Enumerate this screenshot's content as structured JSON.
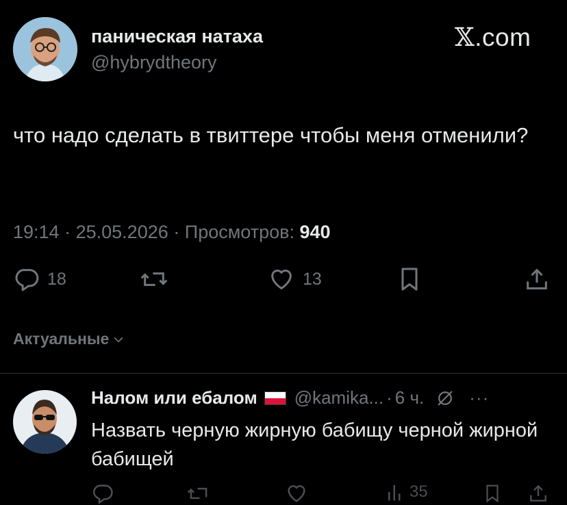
{
  "brand": {
    "x": "𝕏",
    "suffix": ".com"
  },
  "author": {
    "name": "паническая натаха",
    "handle": "@hybrydtheory"
  },
  "tweet": {
    "text": "что надо сделать в твиттере чтобы меня отменили?"
  },
  "meta": {
    "time": "19:14",
    "date": "25.05.2026",
    "views_label": "Просмотров:",
    "views_count": "940"
  },
  "actions": {
    "replies": "18",
    "likes": "13"
  },
  "section": {
    "label": "Актуальные"
  },
  "reply": {
    "name": "Налом или ебалом",
    "handle": "@kamika...",
    "time": "6 ч.",
    "text": "Назвать черную жирную бабищу черной жирной бабищей",
    "views": "35"
  },
  "colors": {
    "background": "#000000",
    "text": "#e7e9ea",
    "muted": "#71767b",
    "divider": "#2f3336"
  }
}
